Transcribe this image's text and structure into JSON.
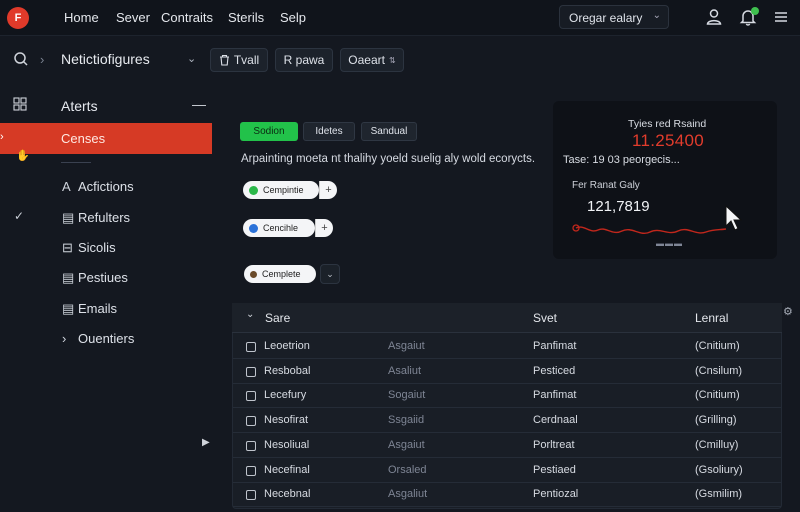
{
  "topbar": {
    "logo_text": "F",
    "nav": [
      "Home",
      "Sever",
      "Contraits",
      "Sterils",
      "Selp"
    ],
    "org_selector": "Oregar ealary"
  },
  "subbar": {
    "title": "Netictiofigures",
    "buttons": [
      {
        "icon": "trash-icon",
        "label": "Tvall"
      },
      {
        "icon": "bold-r-icon",
        "label": "R pawa"
      },
      {
        "icon": "",
        "label": "Oaeart"
      }
    ]
  },
  "sidebar": {
    "header": "Aterts",
    "active_item": "Censes",
    "items": [
      {
        "icon": "A",
        "label": "Acfictions"
      },
      {
        "icon": "▤",
        "label": "Refulters"
      },
      {
        "icon": "⊟",
        "label": "Sicolis"
      },
      {
        "icon": "▤",
        "label": "Pestiues"
      },
      {
        "icon": "▤",
        "label": "Emails"
      },
      {
        "icon": "›",
        "label": "Ouentiers"
      }
    ]
  },
  "main": {
    "pills": [
      "Sodion",
      "Idetes",
      "Sandual"
    ],
    "description": "Arpainting moeta nt thalihy yoeld suelig aly wold ecorycts.",
    "chips": [
      {
        "label": "Cempintie",
        "dot": "#2bb84a"
      },
      {
        "label": "Cencihle",
        "dot": "#2b72d8"
      },
      {
        "label": "Cemplete",
        "dot": "#6a4a2a"
      }
    ]
  },
  "stat_card": {
    "label": "Tyies red Rsaind",
    "value": "11.25400",
    "subtitle": "Tase: 19 03 peorgecis...",
    "label2": "Fer Ranat Galy",
    "value2": "121,7819"
  },
  "table": {
    "columns": [
      "Sare",
      "Svet",
      "Lenral"
    ],
    "rows": [
      [
        "Leoetrion",
        "Asgaiut",
        "Panfimat",
        "(Cnitium)"
      ],
      [
        "Resbobal",
        "Asaliut",
        "Pesticed",
        "(Cnsilum)"
      ],
      [
        "Lecefury",
        "Sogaiut",
        "Panfimat",
        "(Cnitium)"
      ],
      [
        "Nesofirat",
        "Ssgaiid",
        "Cerdnaal",
        "(Grilling)"
      ],
      [
        "Nesoliual",
        "Asgaiut",
        "Porltreat",
        "(Cmilluy)"
      ],
      [
        "Necefinal",
        "Orsaled",
        "Pestiaed",
        "(Gsoliury)"
      ],
      [
        "Necebnal",
        "Asgaliut",
        "Pentiozal",
        "(Gsmilim)"
      ]
    ]
  },
  "colors": {
    "accent": "#d63a25",
    "success": "#2dc253",
    "background": "#141820"
  }
}
